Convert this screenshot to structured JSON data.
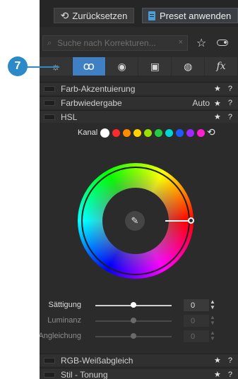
{
  "toolbar": {
    "reset_label": "Zurücksetzen",
    "preset_label": "Preset anwenden"
  },
  "search": {
    "placeholder": "Suche nach Korrekturen...",
    "clear_icon": "×"
  },
  "tabs": [
    {
      "name": "light-icon",
      "glyph": "☼"
    },
    {
      "name": "color-icon",
      "glyph": "ꝏ",
      "active": true
    },
    {
      "name": "detail-icon",
      "glyph": "◉"
    },
    {
      "name": "local-icon",
      "glyph": "▣"
    },
    {
      "name": "geometry-icon",
      "glyph": "◍"
    },
    {
      "name": "effects-icon",
      "glyph": "fx"
    }
  ],
  "callout": {
    "number": "7",
    "color": "#2d8ac8"
  },
  "sections": {
    "farb_akzent": {
      "label": "Farb-Akzentuierung",
      "star": "★",
      "help": "?"
    },
    "farbwiedergabe": {
      "label": "Farbwiedergabe",
      "value": "Auto",
      "star": "★",
      "help": "?"
    },
    "hsl": {
      "label": "HSL",
      "star": "★",
      "help": "?"
    },
    "rgb": {
      "label": "RGB-Weißabgleich",
      "star": "★",
      "help": "?"
    },
    "stil": {
      "label": "Stil - Tonung",
      "star": "★",
      "help": "?"
    }
  },
  "hsl": {
    "kanal_label": "Kanal",
    "channels": [
      "#ffffff",
      "#ff2a2a",
      "#ff8a00",
      "#ffd400",
      "#9be000",
      "#22cc44",
      "#00d8d8",
      "#1e5bff",
      "#9a2aff",
      "#ff1fd0"
    ],
    "reset_icon": "⟲",
    "picker_icon": "⁄",
    "wheel_hue_deg": 0,
    "sliders": [
      {
        "label": "Sättigung",
        "value": "0",
        "position": 0.5,
        "enabled": true
      },
      {
        "label": "Luminanz",
        "value": "0",
        "position": 0.5,
        "enabled": false
      },
      {
        "label": "Angleichung",
        "value": "0",
        "position": 0.5,
        "enabled": false
      }
    ]
  }
}
